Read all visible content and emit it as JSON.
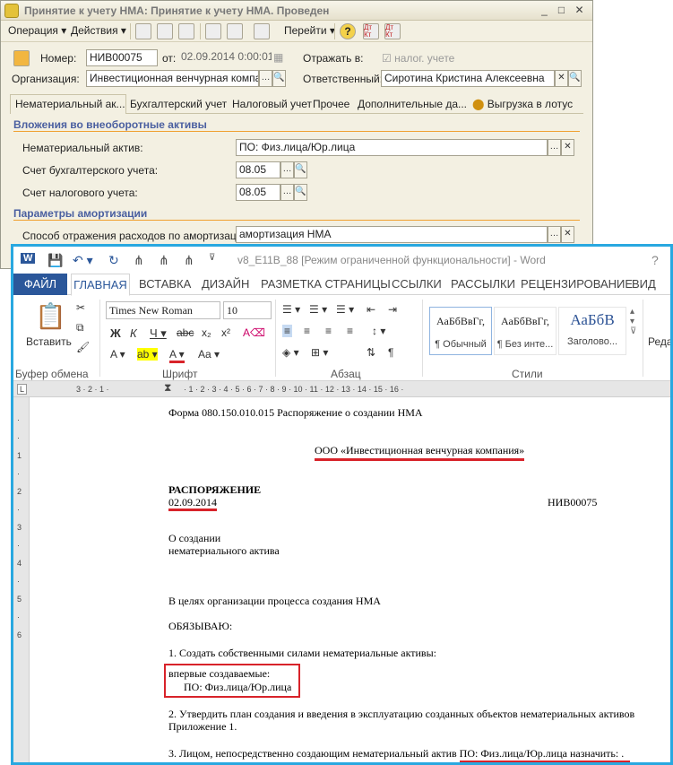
{
  "onec": {
    "title": "Принятие к учету НМА: Принятие к учету НМА. Проведен",
    "menu": {
      "operation": "Операция",
      "actions": "Действия",
      "goto": "Перейти"
    },
    "number_label": "Номер:",
    "number_value": "НИВ00075",
    "from_label": "от:",
    "date_value": "02.09.2014  0:00:01",
    "reflect_label": "Отражать в:",
    "tax_label": "налог. учете",
    "org_label": "Организация:",
    "org_value": "Инвестиционная венчурная компани",
    "resp_label": "Ответственный:",
    "resp_value": "Сиротина Кристина Алексеевна",
    "tabs": [
      "Нематериальный ак...",
      "Бухгалтерский учет",
      "Налоговый учет",
      "Прочее",
      "Дополнительные да..."
    ],
    "export_label": "Выгрузка в лотус",
    "section1": "Вложения во внеоборотные активы",
    "intangible_label": "Нематериальный актив:",
    "intangible_value": "ПО: Физ.лица/Юр.лица",
    "acc_label": "Счет бухгалтерского учета:",
    "acc_value": "08.05",
    "tax_acc_label": "Счет налогового учета:",
    "tax_acc_value": "08.05",
    "section2": "Параметры амортизации",
    "method_label": "Способ отражения расходов по амортизации:",
    "method_value": "амортизация НМА"
  },
  "word": {
    "title": "v8_E11B_88 [Режим ограниченной функциональности] - Word",
    "help": "?",
    "tabs": {
      "file": "ФАЙЛ",
      "home": "ГЛАВНАЯ",
      "insert": "ВСТАВКА",
      "design": "ДИЗАЙН",
      "layout": "РАЗМЕТКА СТРАНИЦЫ",
      "refs": "ССЫЛКИ",
      "mailings": "РАССЫЛКИ",
      "review": "РЕЦЕНЗИРОВАНИЕ",
      "view": "ВИД"
    },
    "paste": "Вставить",
    "font_name": "Times New Roman",
    "font_size": "10",
    "styles": [
      {
        "preview": "АаБбВвГг,",
        "name": "¶ Обычный"
      },
      {
        "preview": "АаБбВвГг,",
        "name": "¶ Без инте..."
      },
      {
        "preview": "АаБбВ",
        "name": "Заголово..."
      }
    ],
    "edit": "Реда",
    "groups": {
      "clipboard": "Буфер обмена",
      "font": "Шрифт",
      "paragraph": "Абзац",
      "styles": "Стили"
    }
  },
  "doc": {
    "form": "Форма 080.150.010.015 Распоряжение о создании НМА",
    "company": "ООО «Инвестиционная венчурная компания»",
    "heading": "РАСПОРЯЖЕНИЕ",
    "date": "02.09.2014",
    "number": "НИВ00075",
    "about1": "О создании",
    "about2": "нематериального актива",
    "purpose": "В целях организации процесса создания НМА",
    "oblige": "ОБЯЗЫВАЮ:",
    "item1": "1.    Создать собственными силами нематериальные активы:",
    "first_created": "впервые создаваемые:",
    "po": "ПО: Физ.лица/Юр.лица",
    "item2a": "2.    Утвердить план создания и введения в эксплуатацию созданных объектов нематериальных активов",
    "item2b": "Приложение 1.",
    "item3": "3.    Лицом, непосредственно создающим нематериальный актив ПО: Физ.лица/Юр.лица назначить: ."
  }
}
